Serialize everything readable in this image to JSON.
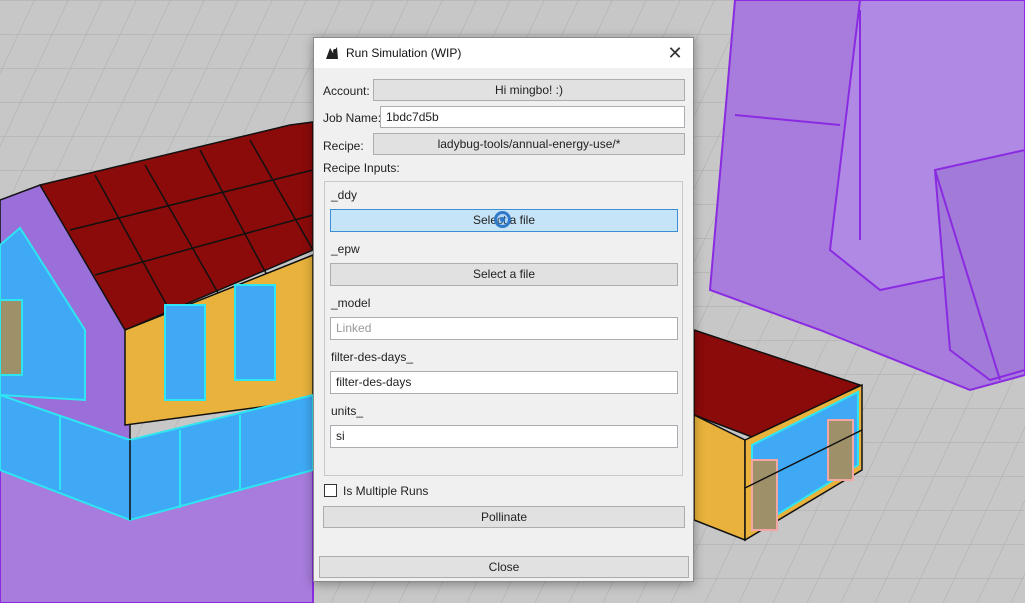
{
  "dialog": {
    "title": "Run Simulation (WIP)",
    "account_label": "Account:",
    "account_button": "Hi mingbo! :)",
    "job_name_label": "Job Name:",
    "job_name_value": "1bdc7d5b",
    "recipe_label": "Recipe:",
    "recipe_button": "ladybug-tools/annual-energy-use/*",
    "recipe_inputs_label": "Recipe Inputs:",
    "inputs": {
      "ddy": {
        "label": "_ddy",
        "button": "Select a file"
      },
      "epw": {
        "label": "_epw",
        "button": "Select a file"
      },
      "model": {
        "label": "_model",
        "value": "Linked"
      },
      "filter_des_days": {
        "label": "filter-des-days_",
        "value": "filter-des-days"
      },
      "units": {
        "label": "units_",
        "value": "si"
      }
    },
    "multiple_runs_label": "Is Multiple Runs",
    "pollinate_button": "Pollinate",
    "close_button": "Close"
  },
  "colors": {
    "roof": "#8b0a0a",
    "wall": "#e8b23c",
    "glass": "#3fa9f5",
    "glass_edge": "#2ee6f2",
    "context": "#a77cdc",
    "ground": "#c4c4c4",
    "hover_button": "#c6e4f8"
  }
}
